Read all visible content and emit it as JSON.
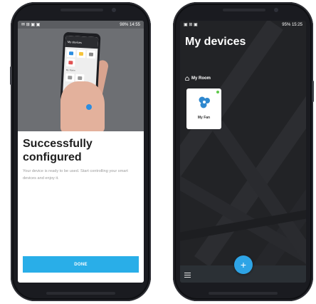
{
  "left_screen": {
    "status": {
      "left_icons": "✉ ⊞ ▣ ▣",
      "right_text": "98% 14:55"
    },
    "hero_phone": {
      "header": "My devices",
      "room": "My Room"
    },
    "title": "Successfully configured",
    "description": "Your device is ready to be used. Start controlling your smart devices and enjoy it.",
    "done_label": "DONE",
    "colors": {
      "accent": "#29aee8"
    }
  },
  "right_screen": {
    "status": {
      "left_icons": "▣ ⊞ ▣",
      "right_text": "95% 15:25"
    },
    "title": "My devices",
    "room_label": "My Room",
    "device": {
      "name": "My Fan",
      "online": true,
      "icon": "fan-icon"
    },
    "fab_label": "+",
    "colors": {
      "fab": "#2ea4e6",
      "online": "#5ec94a",
      "background": "#222326"
    }
  }
}
